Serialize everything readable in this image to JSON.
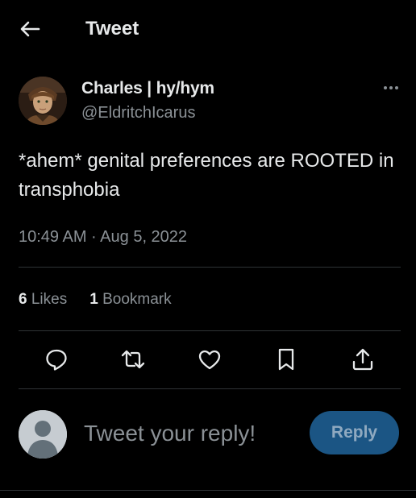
{
  "header": {
    "title": "Tweet"
  },
  "author": {
    "display_name": "Charles | hy/hym",
    "handle": "@EldritchIcarus"
  },
  "tweet": {
    "text": "*ahem* genital preferences are ROOTED in transphobia",
    "timestamp": "10:49 AM · Aug 5, 2022"
  },
  "stats": {
    "likes_count": "6",
    "likes_label": "Likes",
    "bookmarks_count": "1",
    "bookmarks_label": "Bookmark"
  },
  "actions": [
    "reply-icon",
    "retweet-icon",
    "like-icon",
    "bookmark-icon",
    "share-icon"
  ],
  "composer": {
    "placeholder": "Tweet your reply!",
    "reply_label": "Reply"
  },
  "colors": {
    "background": "#000000",
    "text": "#e7e9ea",
    "muted": "#8b9196",
    "divider": "#2f3336",
    "reply_button": "#1b5584"
  }
}
